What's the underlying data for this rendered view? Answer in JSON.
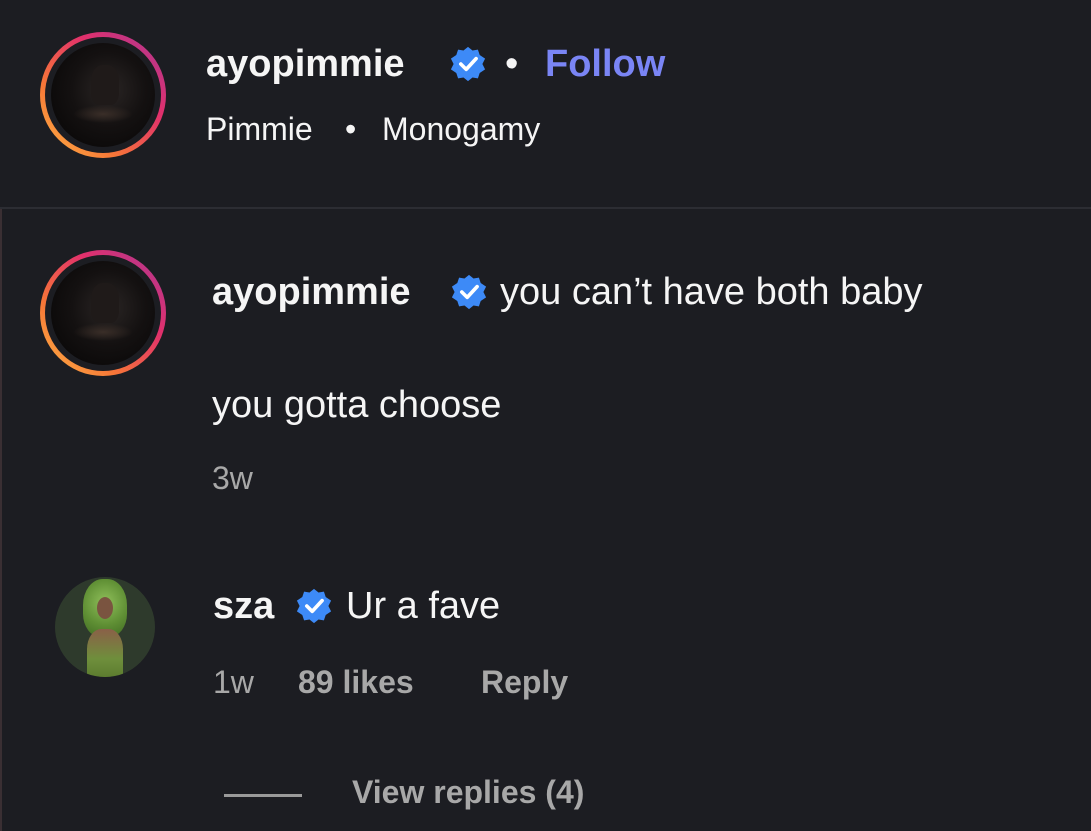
{
  "header": {
    "username": "ayopimmie",
    "separator": "•",
    "follow_label": "Follow",
    "artist": "Pimmie",
    "sub_separator": "•",
    "song": "Monogamy"
  },
  "comments": [
    {
      "username": "ayopimmie",
      "text_line1": "you can’t have both baby",
      "text_line2": "you gotta choose",
      "time": "3w"
    },
    {
      "username": "sza",
      "text": "Ur a fave",
      "time": "1w",
      "likes": "89 likes",
      "reply_label": "Reply",
      "view_replies": "View replies (4)"
    }
  ],
  "icons": {
    "verified": "verified-badge-icon"
  },
  "colors": {
    "background": "#1c1d22",
    "follow": "#7a85f5",
    "verified": "#3d8af7",
    "muted": "#a8a8a8",
    "text": "#f5f5f5"
  }
}
